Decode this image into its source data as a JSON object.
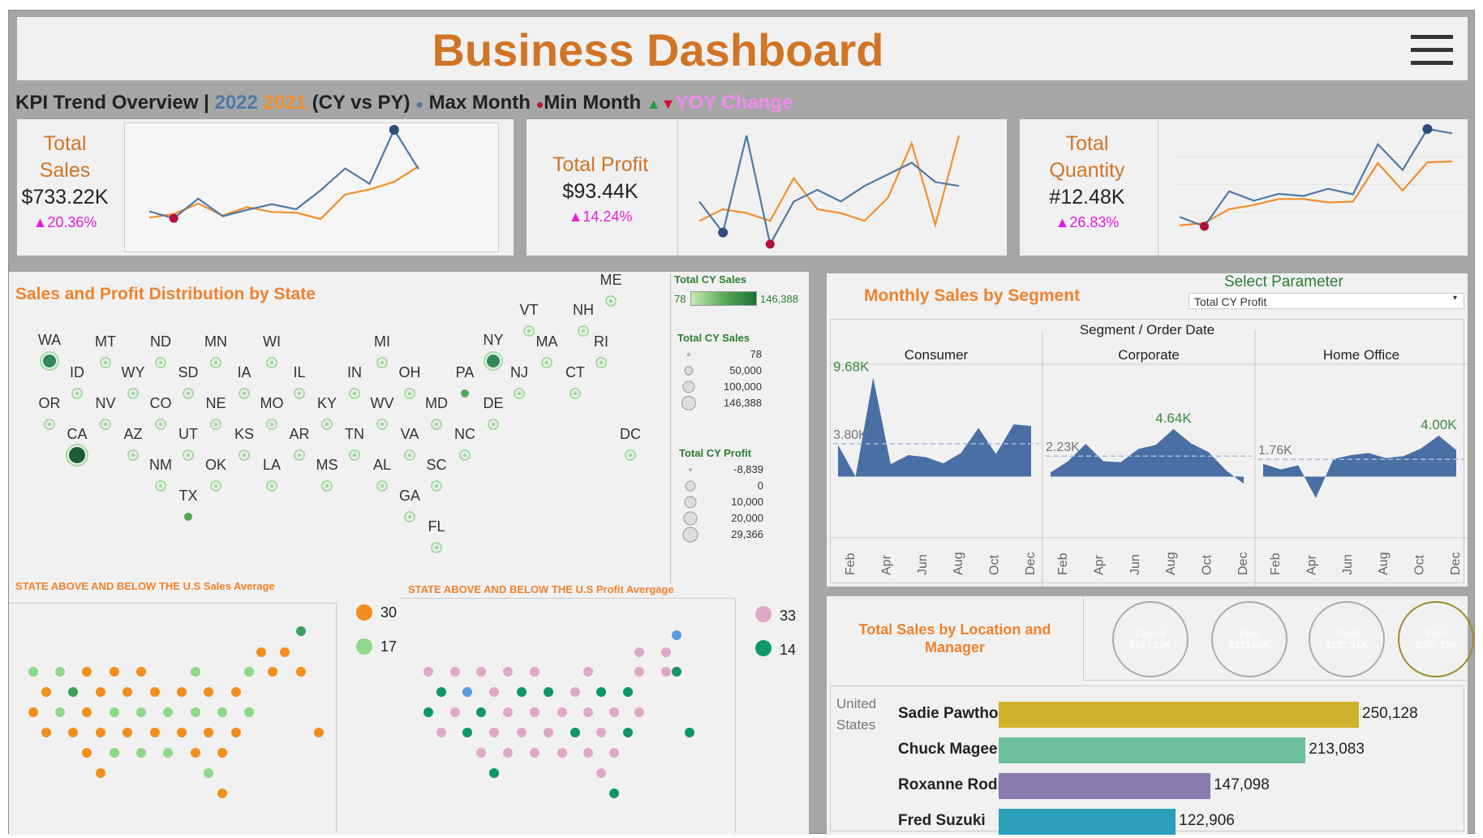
{
  "header": {
    "title": "Business Dashboard"
  },
  "kpi_bar": {
    "lead": "KPI Trend Overview |",
    "cy": "2022",
    "py": "2021",
    "cyvspy": "(CY vs PY)",
    "max_dot": "●",
    "max_label": "Max  Month",
    "min_dot": "●",
    "min_label": "Min Month",
    "up": "▲",
    "down": "▼",
    "yoy": "YOY Change"
  },
  "colors": {
    "cy": "#4e79a7",
    "py": "#f28e2b",
    "orange_title": "#f0822d",
    "magenta": "#e01ee0",
    "green": "#2e7d32",
    "max": "#2c4e7a",
    "min": "#b0103c"
  },
  "kpis": [
    {
      "label1": "Total",
      "label2": "Sales",
      "value": "$733.22K",
      "change": "▲20.36%"
    },
    {
      "label1": "Total Profit",
      "label2": "",
      "value": "$93.44K",
      "change": "▲14.24%"
    },
    {
      "label1": "Total",
      "label2": "Quantity",
      "value": "#12.48K",
      "change": "▲26.83%"
    }
  ],
  "map": {
    "title": "Sales and Profit Distribution by State",
    "states": [
      "ME",
      "VT",
      "NH",
      "WA",
      "MT",
      "ND",
      "MN",
      "WI",
      "MI",
      "NY",
      "MA",
      "RI",
      "ID",
      "WY",
      "SD",
      "IA",
      "IL",
      "IN",
      "OH",
      "PA",
      "NJ",
      "CT",
      "OR",
      "NV",
      "CO",
      "NE",
      "MO",
      "KY",
      "WV",
      "MD",
      "DE",
      "CA",
      "AZ",
      "UT",
      "KS",
      "AR",
      "TN",
      "VA",
      "NC",
      "DC",
      "NM",
      "OK",
      "LA",
      "MS",
      "AL",
      "SC",
      "TX",
      "GA",
      "FL"
    ],
    "legend_sales_color": {
      "title": "Total CY Sales",
      "min": "78",
      "max": "146,388"
    },
    "legend_sales_size": {
      "title": "Total CY Sales",
      "items": [
        "78",
        "50,000",
        "100,000",
        "146,388"
      ]
    },
    "legend_profit_size": {
      "title": "Total CY Profit",
      "items": [
        "-8,839",
        "0",
        "10,000",
        "20,000",
        "29,366"
      ]
    }
  },
  "sales_avg": {
    "title": "STATE ABOVE AND BELOW THE U.S Sales Average",
    "above": "30",
    "below": "17"
  },
  "profit_avg": {
    "title": "STATE ABOVE AND BELOW THE U.S Profit Avergage",
    "above": "33",
    "below": "14"
  },
  "segment": {
    "title": "Monthly Sales by Segment",
    "param_label": "Select Parameter",
    "param_value": "Total CY Profit",
    "axis_title": "Segment / Order Date",
    "panels": [
      {
        "name": "Consumer",
        "max_label": "9.68K",
        "avg_label": "3.80K"
      },
      {
        "name": "Corporate",
        "max_label": "4.64K",
        "avg_label": "2.23K"
      },
      {
        "name": "Home Office",
        "max_label": "4.00K",
        "avg_label": "1.76K"
      }
    ],
    "months": [
      "Feb",
      "Apr",
      "Jun",
      "Aug",
      "Oct",
      "Dec"
    ]
  },
  "location": {
    "title": "Total Sales by Location and Manager",
    "regions": [
      {
        "name": "Central",
        "value": "$147.10K",
        "color": "#8a79ac"
      },
      {
        "name": "East",
        "value": "$213.08K",
        "color": "#6cc09c"
      },
      {
        "name": "South",
        "value": "$122.91K",
        "color": "#2aa0bb"
      },
      {
        "name": "West",
        "value": "$250.13K",
        "color": "#cfb12a"
      }
    ],
    "country1": "United",
    "country2": "States"
  },
  "chart_data": [
    {
      "type": "line",
      "title": "Total Sales",
      "x": [
        1,
        2,
        3,
        4,
        5,
        6,
        7,
        8,
        9,
        10,
        11,
        12
      ],
      "series": [
        {
          "name": "2022",
          "values": [
            29,
            19,
            47,
            22,
            31,
            39,
            32,
            59,
            90,
            68,
            145,
            89
          ]
        },
        {
          "name": "2021",
          "values": [
            20,
            25,
            40,
            23,
            35,
            28,
            27,
            18,
            53,
            60,
            71,
            93
          ]
        }
      ]
    },
    {
      "type": "line",
      "title": "Total Profit",
      "x": [
        1,
        2,
        3,
        4,
        5,
        6,
        7,
        8,
        9,
        10,
        11,
        12
      ],
      "series": [
        {
          "name": "2022",
          "values": [
            6,
            -2,
            23,
            -5,
            6,
            9,
            6,
            10,
            13,
            16,
            11,
            10
          ]
        },
        {
          "name": "2021",
          "values": [
            1,
            4,
            3,
            1,
            12,
            4,
            3,
            1,
            7,
            21,
            0,
            23
          ]
        }
      ]
    },
    {
      "type": "line",
      "title": "Total Quantity",
      "x": [
        1,
        2,
        3,
        4,
        5,
        6,
        7,
        8,
        9,
        10,
        11,
        12
      ],
      "series": [
        {
          "name": "2022",
          "values": [
            550,
            440,
            850,
            740,
            820,
            795,
            880,
            815,
            1400,
            1100,
            1580,
            1530
          ]
        },
        {
          "name": "2021",
          "values": [
            450,
            480,
            640,
            690,
            760,
            760,
            720,
            730,
            1180,
            860,
            1190,
            1200
          ]
        }
      ]
    },
    {
      "type": "area",
      "title": "Monthly Sales by Segment",
      "categories": [
        "Jan",
        "Feb",
        "Mar",
        "Apr",
        "May",
        "Jun",
        "Jul",
        "Aug",
        "Sep",
        "Oct",
        "Nov",
        "Dec"
      ],
      "series": [
        {
          "name": "Consumer",
          "values": [
            3100,
            0,
            9680,
            1200,
            2100,
            1900,
            1300,
            2300,
            4750,
            2200,
            5100,
            4950
          ]
        },
        {
          "name": "Corporate",
          "values": [
            400,
            1500,
            3200,
            1500,
            1400,
            2700,
            3100,
            4640,
            3250,
            2400,
            600,
            -700
          ]
        },
        {
          "name": "Home Office",
          "values": [
            1250,
            700,
            1100,
            -2100,
            1700,
            2100,
            2300,
            1800,
            2000,
            2750,
            4000,
            2600
          ]
        }
      ]
    },
    {
      "type": "bar",
      "title": "Total Sales by Location and Manager",
      "categories": [
        "Sadie Pawthorne",
        "Chuck Magee",
        "Roxanne Rodrig..",
        "Fred Suzuki"
      ],
      "values": [
        250128,
        213083,
        147098,
        122906
      ],
      "labels": [
        "250,128",
        "213,083",
        "147,098",
        "122,906"
      ]
    }
  ]
}
